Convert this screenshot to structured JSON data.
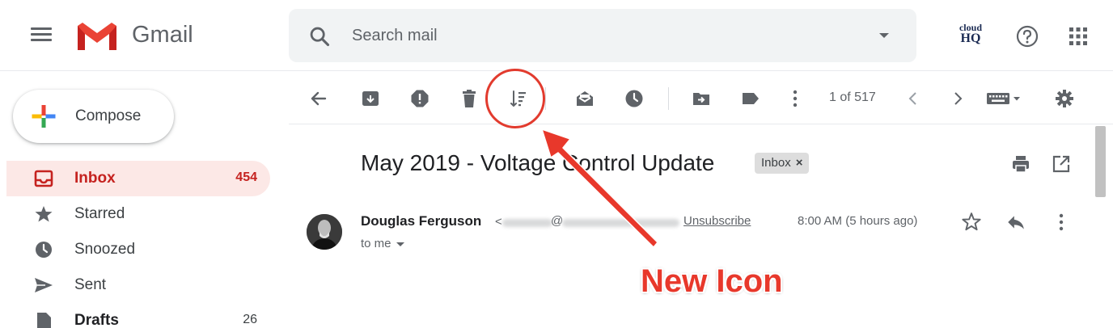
{
  "header": {
    "app_name": "Gmail",
    "search_placeholder": "Search mail",
    "cloudhq_line1": "cloud",
    "cloudhq_line2": "HQ"
  },
  "sidebar": {
    "compose_label": "Compose",
    "items": [
      {
        "label": "Inbox",
        "count": "454",
        "icon": "inbox-icon",
        "active": true
      },
      {
        "label": "Starred",
        "count": "",
        "icon": "star-icon"
      },
      {
        "label": "Snoozed",
        "count": "",
        "icon": "clock-icon"
      },
      {
        "label": "Sent",
        "count": "",
        "icon": "send-icon"
      },
      {
        "label": "Drafts",
        "count": "26",
        "icon": "draft-icon"
      }
    ]
  },
  "toolbar": {
    "pager": "1 of 517",
    "icons": [
      "back-arrow-icon",
      "archive-icon",
      "report-spam-icon",
      "delete-icon",
      "sort-icon",
      "mark-unread-icon",
      "snooze-icon",
      "move-to-icon",
      "label-icon",
      "more-vert-icon",
      "chevron-left-icon",
      "chevron-right-icon",
      "keyboard-icon",
      "settings-icon"
    ]
  },
  "message": {
    "subject": "May 2019 - Voltage Control Update",
    "label_chip": "Inbox",
    "label_chip_close": "×",
    "sender_name": "Douglas Ferguson",
    "sender_email_open": "<",
    "sender_email_at": "@",
    "unsubscribe": "Unsubscribe",
    "timestamp": "8:00 AM (5 hours ago)",
    "recipient": "to me"
  },
  "annotation": {
    "text": "New Icon"
  },
  "colors": {
    "accent_red": "#e8382b",
    "inbox_active_bg": "#fce8e6",
    "inbox_active_text": "#c5221f",
    "search_bg": "#f1f3f4"
  }
}
